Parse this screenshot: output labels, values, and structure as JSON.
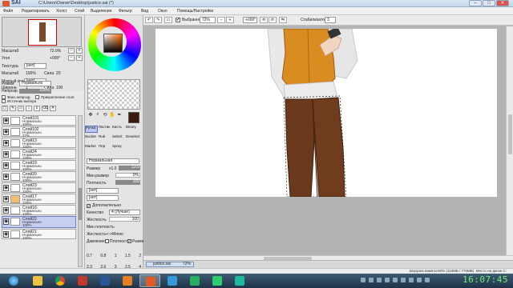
{
  "title_bar": {
    "brand": "SAI",
    "path": "C:\\Users\\Owner\\Desktop\\justice.sai (*)",
    "min": "–",
    "max": "□",
    "close": "✕"
  },
  "menu": [
    "Файл",
    "Редактировать",
    "Холст",
    "Слой",
    "Выделение",
    "Фильтр",
    "Вид",
    "Окно",
    "Помощь/Настройки"
  ],
  "toolbar": {
    "selection_checkbox": "✔",
    "selection_label": "Выбранное",
    "zoom": "72%",
    "angle": "+000°",
    "stabilizer_label": "Стабилизатор",
    "stabilizer_value": "3"
  },
  "navigator": {
    "zoom_label": "Масштаб",
    "zoom_value": "72.0%",
    "angle_label": "Угол",
    "angle_value": "+000°"
  },
  "texture": {
    "texture_label": "Текстура",
    "texture_value": "[нет]",
    "scale_label": "Масштаб",
    "scale_value": "100%",
    "strength_label": "Сила",
    "strength_value": "20",
    "edge_label": "Мокрый край",
    "edge_value": "[нет]",
    "width_label": "Ширина",
    "width_value": "1",
    "intensity_label": "Сила",
    "intensity_value": "100"
  },
  "blend": {
    "mode_label": "Режим",
    "mode_value": "Нормально",
    "opacity_label": "Непрозр.",
    "opacity_value": "100%",
    "fix_opacity": "Фикс.непрозр.",
    "clip_group": "Прикрепление слоя",
    "selection_source": "Источник выбора"
  },
  "layers": [
    {
      "name": "Слой101",
      "mode": "Нормально",
      "opacity": "100%",
      "selected": false
    },
    {
      "name": "Слой102",
      "mode": "Нормально",
      "opacity": "27%",
      "selected": false
    },
    {
      "name": "Слой13",
      "mode": "Нормально",
      "opacity": "100%",
      "selected": false
    },
    {
      "name": "Слой24",
      "mode": "Нормально",
      "opacity": "100%",
      "selected": false
    },
    {
      "name": "Слой19",
      "mode": "Нормально",
      "opacity": "100%",
      "selected": false
    },
    {
      "name": "Слой20",
      "mode": "Нормально",
      "opacity": "100%",
      "selected": false
    },
    {
      "name": "Слой23",
      "mode": "Нормально",
      "opacity": "100%",
      "selected": false
    },
    {
      "name": "Слой17",
      "mode": "Нормально",
      "opacity": "100%",
      "selected": false
    },
    {
      "name": "Слой16",
      "mode": "Нормально",
      "opacity": "100%",
      "selected": false
    },
    {
      "name": "Слой22",
      "mode": "Нормально",
      "opacity": "100%",
      "selected": true
    },
    {
      "name": "Слой21",
      "mode": "Нормально",
      "opacity": "100%",
      "selected": false
    }
  ],
  "tools": [
    [
      "Ручка",
      "Ластик",
      "Кисть",
      "Binary"
    ],
    [
      "Bucket",
      "Rub",
      "Select",
      "Deselect"
    ],
    [
      "Marker",
      "Пер",
      "Spray",
      ""
    ]
  ],
  "brush": {
    "preset": "Нормальная",
    "size_label": "Размер",
    "size_mult": "x1.0",
    "size_value": "12.0",
    "min_size_label": "Мин.размер",
    "min_size_value": "0%",
    "density_label": "Плотность",
    "density_value": "100",
    "shape_value": "[нет]",
    "texture_value": "[нет]",
    "advanced_label": "Дополнительно",
    "quality_label": "Качество",
    "quality_value": "4 (Лучше)",
    "hardness_label": "Жесткость",
    "hardness_value": "100",
    "min_density_label": "Мин плотность",
    "max_pressure_label": "Жесткость<->Мягко",
    "pressure_label": "Давление",
    "pressure_density": "Плотность",
    "pressure_size": "Размер",
    "size_presets_row1": [
      "0.7",
      "0.8",
      "1",
      "1.5",
      "2"
    ],
    "size_presets_row2": [
      "2.3",
      "2.6",
      "3",
      "3.5",
      "4"
    ]
  },
  "tab": {
    "name": "justice.sai",
    "zoom": "72%"
  },
  "status": {
    "memory": "Загрузка памяти:60% (110МБ / 770МБ)",
    "drive": "Место на диске C:"
  },
  "clock": "16:07:45",
  "colors": {
    "accent": "#6b7cc4",
    "vest": "#d98c1f",
    "pants": "#6b3a1c",
    "shirt": "#e9e9ea"
  }
}
